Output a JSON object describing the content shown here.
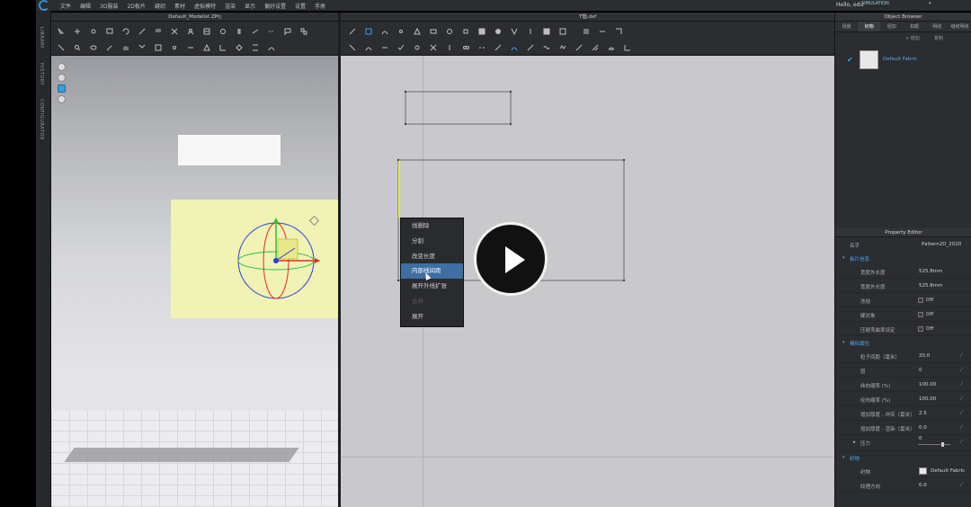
{
  "menubar": {
    "items": [
      "文件",
      "编辑",
      "3D服装",
      "2D板片",
      "缝纫",
      "素材",
      "虚拟模特",
      "渲染",
      "显示",
      "偏好设置",
      "设置",
      "手册"
    ],
    "user": "Hello, edu",
    "mode": "SIMULATION"
  },
  "sidebar": {
    "tabs": [
      "LIBRARY",
      "HISTORY",
      "CONFIGURATOR"
    ]
  },
  "view3d": {
    "title": "Default_Modelist.ZPrj"
  },
  "view2d": {
    "title": "T恤.dxf"
  },
  "context_menu": {
    "items": [
      {
        "label": "线删除",
        "state": "normal"
      },
      {
        "label": "分割",
        "state": "normal"
      },
      {
        "label": "改变长度",
        "state": "normal"
      },
      {
        "label": "内部线间距",
        "state": "selected"
      },
      {
        "label": "展开外线扩张",
        "state": "normal"
      },
      {
        "label": "合并",
        "state": "disabled"
      },
      {
        "label": "展开",
        "state": "normal"
      }
    ]
  },
  "object_browser": {
    "title": "Object Browser",
    "tabs": [
      "场景",
      "织物",
      "纽扣",
      "扣眼",
      "明线",
      "缝纫明线"
    ],
    "active_tab": "织物",
    "actions": {
      "add": "+ 增加",
      "copy": "复制"
    },
    "fabric_name": "Default Fabric"
  },
  "property_editor": {
    "title": "Property Editor",
    "name_label": "名字",
    "name_value": "Pattern2D_2020",
    "sections": {
      "info": "板片信息",
      "sim": "模拟属性",
      "fabric": "织物"
    },
    "info_rows": [
      {
        "key": "宽度外长度",
        "value": "525.8mm"
      },
      {
        "key": "宽度外长度",
        "value": "525.8mm"
      }
    ],
    "check_rows": [
      {
        "key": "冻结",
        "value": "Off"
      },
      {
        "key": "硬对象",
        "value": "Off"
      },
      {
        "key": "压缩弯曲率设定",
        "value": "Off"
      }
    ],
    "sim_rows": [
      {
        "key": "粒子间距（毫米）",
        "value": "20.0"
      },
      {
        "key": "层",
        "value": "0"
      },
      {
        "key": "纬向缩率 (%)",
        "value": "100.00"
      },
      {
        "key": "经向缩率 (%)",
        "value": "100.00"
      },
      {
        "key": "增加厚度 - 冲突（毫米）",
        "value": "2.5"
      },
      {
        "key": "增加厚度 - 渲染（毫米）",
        "value": "0.0"
      }
    ],
    "pressure": {
      "key": "压力",
      "value": "0"
    },
    "fabric_rows": [
      {
        "key": "织物",
        "value": "Default Fabric"
      },
      {
        "key": "纹理方向",
        "value": "0.0"
      }
    ]
  },
  "colors": {
    "accent": "#3aa0e8",
    "selected_menu": "#3f6ea0",
    "pattern_yellow": "#f0f3b4",
    "gizmo_red": "#e02b2b",
    "gizmo_green": "#2fbf3c",
    "gizmo_blue": "#2a3fd6"
  }
}
